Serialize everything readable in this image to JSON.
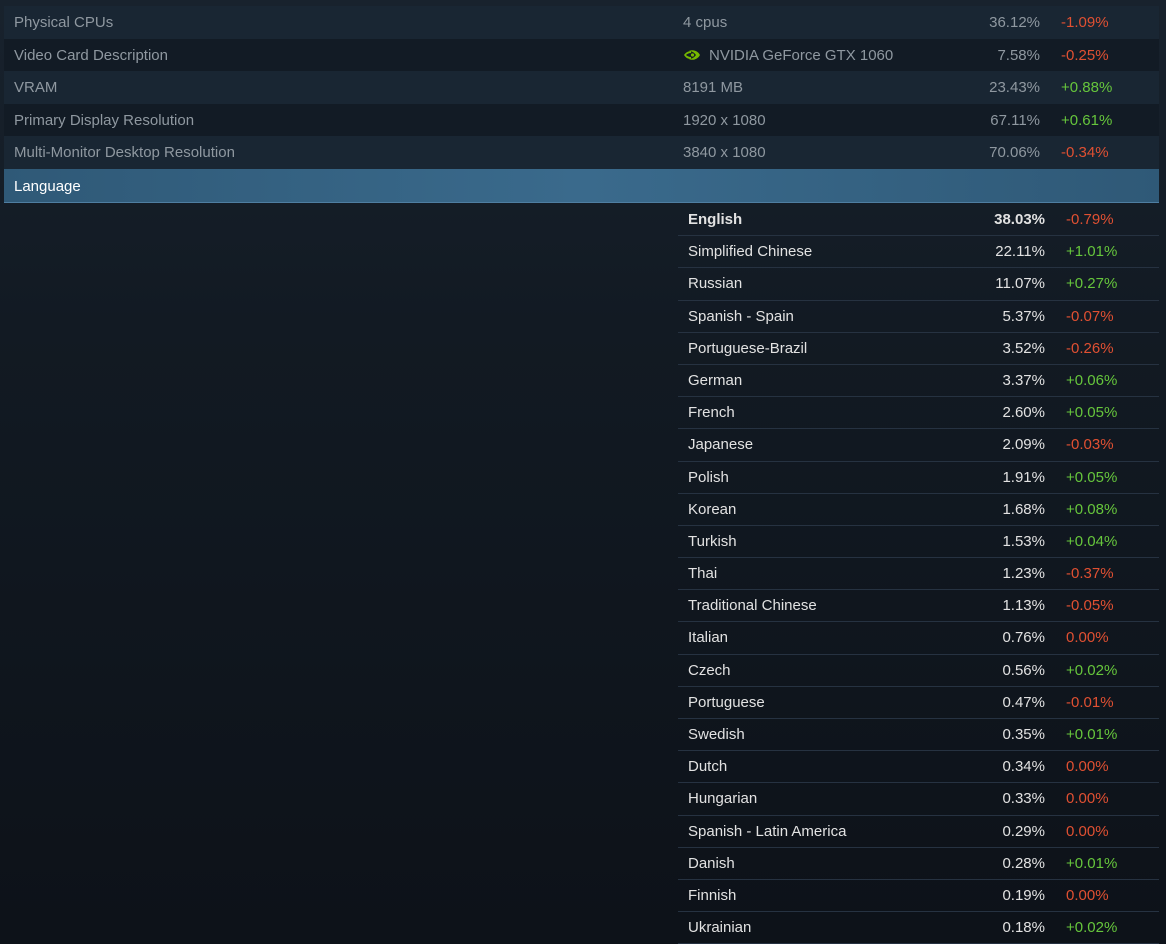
{
  "summary_rows": [
    {
      "label": "Physical CPUs",
      "value": "4 cpus",
      "pct": "36.12%",
      "change": "-1.09%",
      "trend": "neg",
      "icon": null
    },
    {
      "label": "Video Card Description",
      "value": "NVIDIA GeForce GTX 1060",
      "pct": "7.58%",
      "change": "-0.25%",
      "trend": "neg",
      "icon": "nvidia-logo-icon"
    },
    {
      "label": "VRAM",
      "value": "8191 MB",
      "pct": "23.43%",
      "change": "+0.88%",
      "trend": "pos",
      "icon": null
    },
    {
      "label": "Primary Display Resolution",
      "value": "1920 x 1080",
      "pct": "67.11%",
      "change": "+0.61%",
      "trend": "pos",
      "icon": null
    },
    {
      "label": "Multi-Monitor Desktop Resolution",
      "value": "3840 x 1080",
      "pct": "70.06%",
      "change": "-0.34%",
      "trend": "neg",
      "icon": null
    }
  ],
  "language_section": {
    "title": "Language",
    "rows": [
      {
        "name": "English",
        "pct": "38.03%",
        "change": "-0.79%",
        "trend": "neg",
        "highlight": true
      },
      {
        "name": "Simplified Chinese",
        "pct": "22.11%",
        "change": "+1.01%",
        "trend": "pos"
      },
      {
        "name": "Russian",
        "pct": "11.07%",
        "change": "+0.27%",
        "trend": "pos"
      },
      {
        "name": "Spanish - Spain",
        "pct": "5.37%",
        "change": "-0.07%",
        "trend": "neg"
      },
      {
        "name": "Portuguese-Brazil",
        "pct": "3.52%",
        "change": "-0.26%",
        "trend": "neg"
      },
      {
        "name": "German",
        "pct": "3.37%",
        "change": "+0.06%",
        "trend": "pos"
      },
      {
        "name": "French",
        "pct": "2.60%",
        "change": "+0.05%",
        "trend": "pos"
      },
      {
        "name": "Japanese",
        "pct": "2.09%",
        "change": "-0.03%",
        "trend": "neg"
      },
      {
        "name": "Polish",
        "pct": "1.91%",
        "change": "+0.05%",
        "trend": "pos"
      },
      {
        "name": "Korean",
        "pct": "1.68%",
        "change": "+0.08%",
        "trend": "pos"
      },
      {
        "name": "Turkish",
        "pct": "1.53%",
        "change": "+0.04%",
        "trend": "pos"
      },
      {
        "name": "Thai",
        "pct": "1.23%",
        "change": "-0.37%",
        "trend": "neg"
      },
      {
        "name": "Traditional Chinese",
        "pct": "1.13%",
        "change": "-0.05%",
        "trend": "neg"
      },
      {
        "name": "Italian",
        "pct": "0.76%",
        "change": "0.00%",
        "trend": "zero"
      },
      {
        "name": "Czech",
        "pct": "0.56%",
        "change": "+0.02%",
        "trend": "pos"
      },
      {
        "name": "Portuguese",
        "pct": "0.47%",
        "change": "-0.01%",
        "trend": "neg"
      },
      {
        "name": "Swedish",
        "pct": "0.35%",
        "change": "+0.01%",
        "trend": "pos"
      },
      {
        "name": "Dutch",
        "pct": "0.34%",
        "change": "0.00%",
        "trend": "zero"
      },
      {
        "name": "Hungarian",
        "pct": "0.33%",
        "change": "0.00%",
        "trend": "zero"
      },
      {
        "name": "Spanish - Latin America",
        "pct": "0.29%",
        "change": "0.00%",
        "trend": "zero"
      },
      {
        "name": "Danish",
        "pct": "0.28%",
        "change": "+0.01%",
        "trend": "pos"
      },
      {
        "name": "Finnish",
        "pct": "0.19%",
        "change": "0.00%",
        "trend": "zero"
      },
      {
        "name": "Ukrainian",
        "pct": "0.18%",
        "change": "+0.02%",
        "trend": "pos"
      }
    ]
  },
  "colors": {
    "negative": "#e05032",
    "positive": "#66c63c",
    "header_bg": "#3a6a8c",
    "nvidia_green": "#76b900"
  }
}
